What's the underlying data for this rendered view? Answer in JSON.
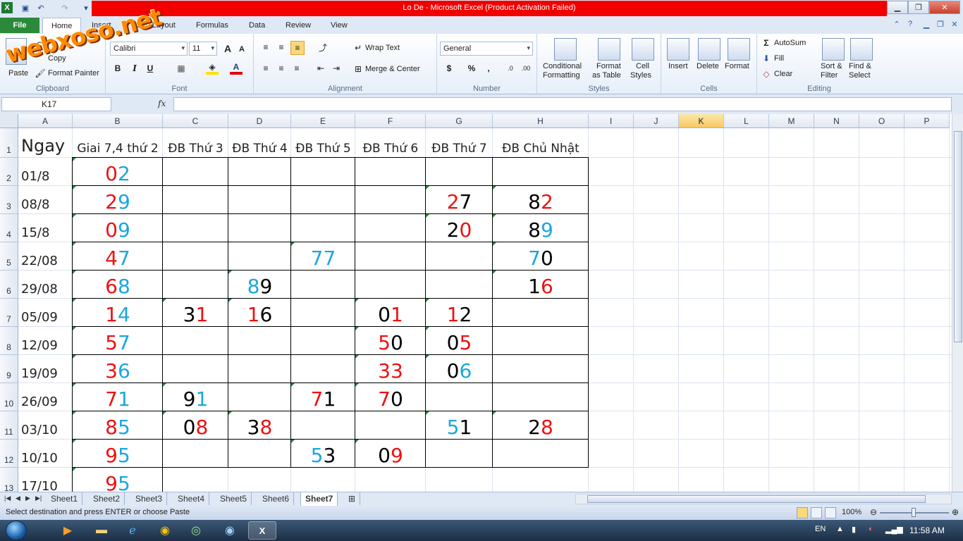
{
  "window": {
    "title": "Lo De  -  Microsoft Excel (Product Activation Failed)"
  },
  "watermark": "webxoso.net",
  "ribbon": {
    "file_tab": "File",
    "tabs": [
      "Home",
      "Insert",
      "Page Layout",
      "Formulas",
      "Data",
      "Review",
      "View"
    ],
    "clipboard": {
      "paste": "Paste",
      "cut": "Cut",
      "copy": "Copy",
      "format_painter": "Format Painter",
      "label": "Clipboard"
    },
    "font": {
      "name": "Calibri",
      "size": "11",
      "bold": "B",
      "italic": "I",
      "underline": "U",
      "label": "Font"
    },
    "alignment": {
      "wrap_text": "Wrap Text",
      "merge_center": "Merge & Center",
      "label": "Alignment"
    },
    "number": {
      "format": "General",
      "currency": "$",
      "percent": "%",
      "comma": ",",
      "label": "Number"
    },
    "styles": {
      "conditional": "Conditional",
      "conditional2": "Formatting",
      "format_as": "Format",
      "format_as2": "as Table",
      "cell": "Cell",
      "cell2": "Styles",
      "label": "Styles"
    },
    "cells": {
      "insert": "Insert",
      "delete": "Delete",
      "format": "Format",
      "label": "Cells"
    },
    "editing": {
      "autosum": "AutoSum",
      "fill": "Fill",
      "clear": "Clear",
      "sort": "Sort &",
      "sort2": "Filter",
      "find": "Find &",
      "find2": "Select",
      "label": "Editing"
    }
  },
  "formula_bar": {
    "name_box": "K17",
    "fx": "fx",
    "formula": ""
  },
  "grid": {
    "columns": [
      "A",
      "B",
      "C",
      "D",
      "E",
      "F",
      "G",
      "H",
      "I",
      "J",
      "K",
      "L",
      "M",
      "N",
      "O",
      "P"
    ],
    "selected_column": "K",
    "rows": [
      "1",
      "2",
      "3",
      "4",
      "5",
      "6",
      "7",
      "8",
      "9",
      "10",
      "11",
      "12",
      "13"
    ],
    "headers": [
      "Ngay",
      "Giai 7,4 thứ 2",
      "ĐB Thứ 3",
      "ĐB Thứ 4",
      "ĐB Thứ 5",
      "ĐB Thứ 6",
      "ĐB Thứ 7",
      "ĐB Chủ Nhật"
    ],
    "dates": [
      "01/8",
      "08/8",
      "15/8",
      "22/08",
      "29/08",
      "05/09",
      "12/09",
      "19/09",
      "26/09",
      "03/10",
      "10/10",
      "17/10"
    ],
    "colors": {
      "red": "#ee1111",
      "blue": "#1aa7e0",
      "black": "#000000"
    },
    "entries": [
      {
        "r": 0,
        "c": 1,
        "d1": "0",
        "c1": "red",
        "d2": "2",
        "c2": "blue"
      },
      {
        "r": 1,
        "c": 1,
        "d1": "2",
        "c1": "red",
        "d2": "9",
        "c2": "blue"
      },
      {
        "r": 1,
        "c": 6,
        "d1": "2",
        "c1": "red",
        "d2": "7",
        "c2": "black"
      },
      {
        "r": 1,
        "c": 7,
        "d1": "8",
        "c1": "black",
        "d2": "2",
        "c2": "red"
      },
      {
        "r": 2,
        "c": 1,
        "d1": "0",
        "c1": "red",
        "d2": "9",
        "c2": "blue"
      },
      {
        "r": 2,
        "c": 6,
        "d1": "2",
        "c1": "black",
        "d2": "0",
        "c2": "red"
      },
      {
        "r": 2,
        "c": 7,
        "d1": "8",
        "c1": "black",
        "d2": "9",
        "c2": "blue"
      },
      {
        "r": 3,
        "c": 1,
        "d1": "4",
        "c1": "red",
        "d2": "7",
        "c2": "blue"
      },
      {
        "r": 3,
        "c": 4,
        "d1": "7",
        "c1": "blue",
        "d2": "7",
        "c2": "blue"
      },
      {
        "r": 3,
        "c": 7,
        "d1": "7",
        "c1": "blue",
        "d2": "0",
        "c2": "black"
      },
      {
        "r": 4,
        "c": 1,
        "d1": "6",
        "c1": "red",
        "d2": "8",
        "c2": "blue"
      },
      {
        "r": 4,
        "c": 3,
        "d1": "8",
        "c1": "blue",
        "d2": "9",
        "c2": "black"
      },
      {
        "r": 4,
        "c": 7,
        "d1": "1",
        "c1": "black",
        "d2": "6",
        "c2": "red"
      },
      {
        "r": 5,
        "c": 1,
        "d1": "1",
        "c1": "red",
        "d2": "4",
        "c2": "blue"
      },
      {
        "r": 5,
        "c": 2,
        "d1": "3",
        "c1": "black",
        "d2": "1",
        "c2": "red"
      },
      {
        "r": 5,
        "c": 3,
        "d1": "1",
        "c1": "red",
        "d2": "6",
        "c2": "black"
      },
      {
        "r": 5,
        "c": 5,
        "d1": "0",
        "c1": "black",
        "d2": "1",
        "c2": "red"
      },
      {
        "r": 5,
        "c": 6,
        "d1": "1",
        "c1": "red",
        "d2": "2",
        "c2": "black"
      },
      {
        "r": 6,
        "c": 1,
        "d1": "5",
        "c1": "red",
        "d2": "7",
        "c2": "blue"
      },
      {
        "r": 6,
        "c": 5,
        "d1": "5",
        "c1": "red",
        "d2": "0",
        "c2": "black"
      },
      {
        "r": 6,
        "c": 6,
        "d1": "0",
        "c1": "black",
        "d2": "5",
        "c2": "red"
      },
      {
        "r": 7,
        "c": 1,
        "d1": "3",
        "c1": "red",
        "d2": "6",
        "c2": "blue"
      },
      {
        "r": 7,
        "c": 5,
        "d1": "3",
        "c1": "red",
        "d2": "3",
        "c2": "red"
      },
      {
        "r": 7,
        "c": 6,
        "d1": "0",
        "c1": "black",
        "d2": "6",
        "c2": "blue"
      },
      {
        "r": 8,
        "c": 1,
        "d1": "7",
        "c1": "red",
        "d2": "1",
        "c2": "blue"
      },
      {
        "r": 8,
        "c": 2,
        "d1": "9",
        "c1": "black",
        "d2": "1",
        "c2": "blue"
      },
      {
        "r": 8,
        "c": 4,
        "d1": "7",
        "c1": "red",
        "d2": "1",
        "c2": "black"
      },
      {
        "r": 8,
        "c": 5,
        "d1": "7",
        "c1": "red",
        "d2": "0",
        "c2": "black"
      },
      {
        "r": 9,
        "c": 1,
        "d1": "8",
        "c1": "red",
        "d2": "5",
        "c2": "blue"
      },
      {
        "r": 9,
        "c": 2,
        "d1": "0",
        "c1": "black",
        "d2": "8",
        "c2": "red"
      },
      {
        "r": 9,
        "c": 3,
        "d1": "3",
        "c1": "black",
        "d2": "8",
        "c2": "red"
      },
      {
        "r": 9,
        "c": 6,
        "d1": "5",
        "c1": "blue",
        "d2": "1",
        "c2": "black"
      },
      {
        "r": 9,
        "c": 7,
        "d1": "2",
        "c1": "black",
        "d2": "8",
        "c2": "red"
      },
      {
        "r": 10,
        "c": 1,
        "d1": "9",
        "c1": "red",
        "d2": "5",
        "c2": "blue"
      },
      {
        "r": 10,
        "c": 4,
        "d1": "5",
        "c1": "blue",
        "d2": "3",
        "c2": "black"
      },
      {
        "r": 10,
        "c": 5,
        "d1": "0",
        "c1": "black",
        "d2": "9",
        "c2": "red"
      },
      {
        "r": 11,
        "c": 1,
        "d1": "9",
        "c1": "red",
        "d2": "5",
        "c2": "blue"
      }
    ]
  },
  "sheets": {
    "tabs": [
      "Sheet1",
      "Sheet2",
      "Sheet3",
      "Sheet4",
      "Sheet5",
      "Sheet6",
      "Sheet7"
    ],
    "active": "Sheet7"
  },
  "status": {
    "message": "Select destination and press ENTER or choose Paste",
    "zoom": "100%"
  },
  "taskbar": {
    "language": "EN",
    "time": "11:58 AM"
  }
}
